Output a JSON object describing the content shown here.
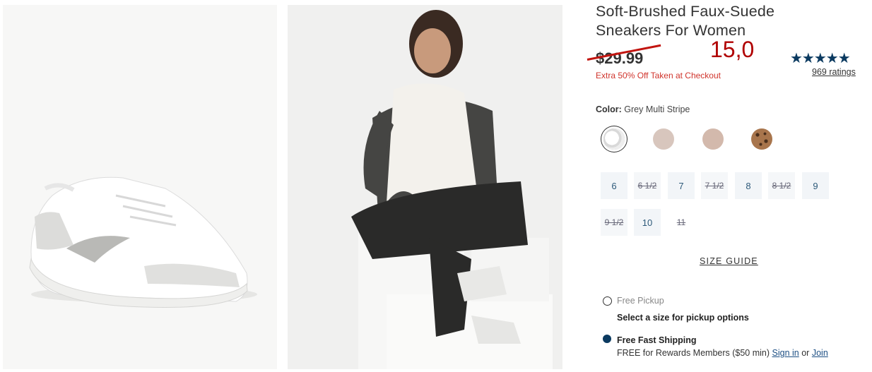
{
  "product": {
    "title_line1": "Soft-Brushed Faux-Suede",
    "title_line2": "Sneakers For Women",
    "old_price": "$29.99",
    "new_price": "15,0",
    "promo": "Extra 50% Off Taken at Checkout",
    "stars": "★★★★★",
    "ratings": "969 ratings"
  },
  "color": {
    "label": "Color:",
    "value": "Grey Multi Stripe",
    "swatches": [
      {
        "name": "grey-multi-stripe",
        "color": "#ececec",
        "selected": true
      },
      {
        "name": "blush",
        "color": "#d8c6bd"
      },
      {
        "name": "tan",
        "color": "#d3b9ac"
      },
      {
        "name": "leopard",
        "color": "#9a6a44"
      }
    ]
  },
  "sizes": [
    {
      "label": "6",
      "available": true
    },
    {
      "label": "6 1/2",
      "available": false
    },
    {
      "label": "7",
      "available": true
    },
    {
      "label": "7 1/2",
      "available": false
    },
    {
      "label": "8",
      "available": true
    },
    {
      "label": "8 1/2",
      "available": false
    },
    {
      "label": "9",
      "available": true
    },
    {
      "label": "9 1/2",
      "available": false
    },
    {
      "label": "10",
      "available": true
    },
    {
      "label": "11",
      "available": false
    }
  ],
  "size_guide": "SIZE GUIDE",
  "fulfillment": {
    "pickup_label": "Free Pickup",
    "pickup_note": "Select a size for pickup options",
    "shipping_label": "Free Fast Shipping",
    "shipping_note_prefix": "FREE for Rewards Members ($50 min)",
    "sign_in": "Sign in",
    "or": "or",
    "join": "Join"
  },
  "colors": {
    "accent_navy": "#0b3a60",
    "sale_red": "#b00000",
    "promo_red": "#d0342c"
  }
}
